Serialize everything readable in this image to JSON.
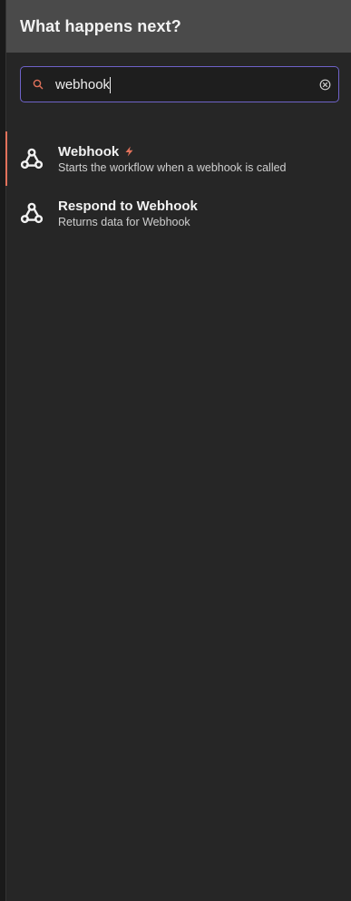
{
  "header": {
    "title": "What happens next?"
  },
  "search": {
    "value": "webhook"
  },
  "results": [
    {
      "title": "Webhook",
      "description": "Starts the workflow when a webhook is called",
      "icon": "webhook-icon",
      "badge_icon": "bolt-icon",
      "active": true
    },
    {
      "title": "Respond to Webhook",
      "description": "Returns data for Webhook",
      "icon": "webhook-icon",
      "active": false
    }
  ],
  "colors": {
    "accent": "#e2725b",
    "search_border": "#6f63c9",
    "header_bg": "#4a4a4a",
    "panel_bg": "#262626"
  }
}
